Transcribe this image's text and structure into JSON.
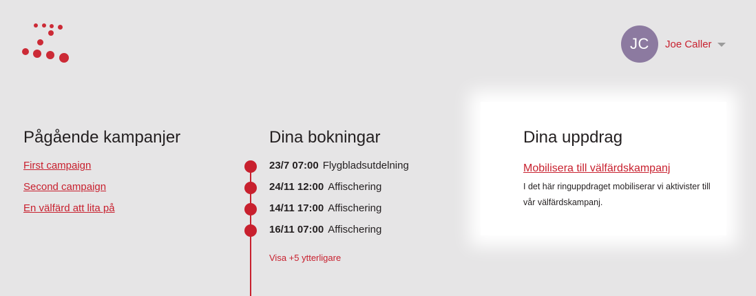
{
  "user": {
    "initials": "JC",
    "name": "Joe Caller"
  },
  "campaigns": {
    "title": "Pågående kampanjer",
    "items": [
      "First campaign",
      "Second campaign",
      "En välfärd att lita på"
    ]
  },
  "bookings": {
    "title": "Dina bokningar",
    "items": [
      {
        "when": "23/7 07:00",
        "what": "Flygbladsutdelning"
      },
      {
        "when": "24/11 12:00",
        "what": "Affischering"
      },
      {
        "when": "14/11 17:00",
        "what": "Affischering"
      },
      {
        "when": "16/11 07:00",
        "what": "Affischering"
      }
    ],
    "more": "Visa +5 ytterligare"
  },
  "assignments": {
    "title": "Dina uppdrag",
    "link": "Mobilisera till välfärdskampanj",
    "description": "I det här ringuppdraget mobiliserar vi aktivister till vår välfärdskampanj."
  },
  "colors": {
    "accent": "#c8202e",
    "avatar": "#8c7aa0",
    "background": "#e6e5e6"
  }
}
